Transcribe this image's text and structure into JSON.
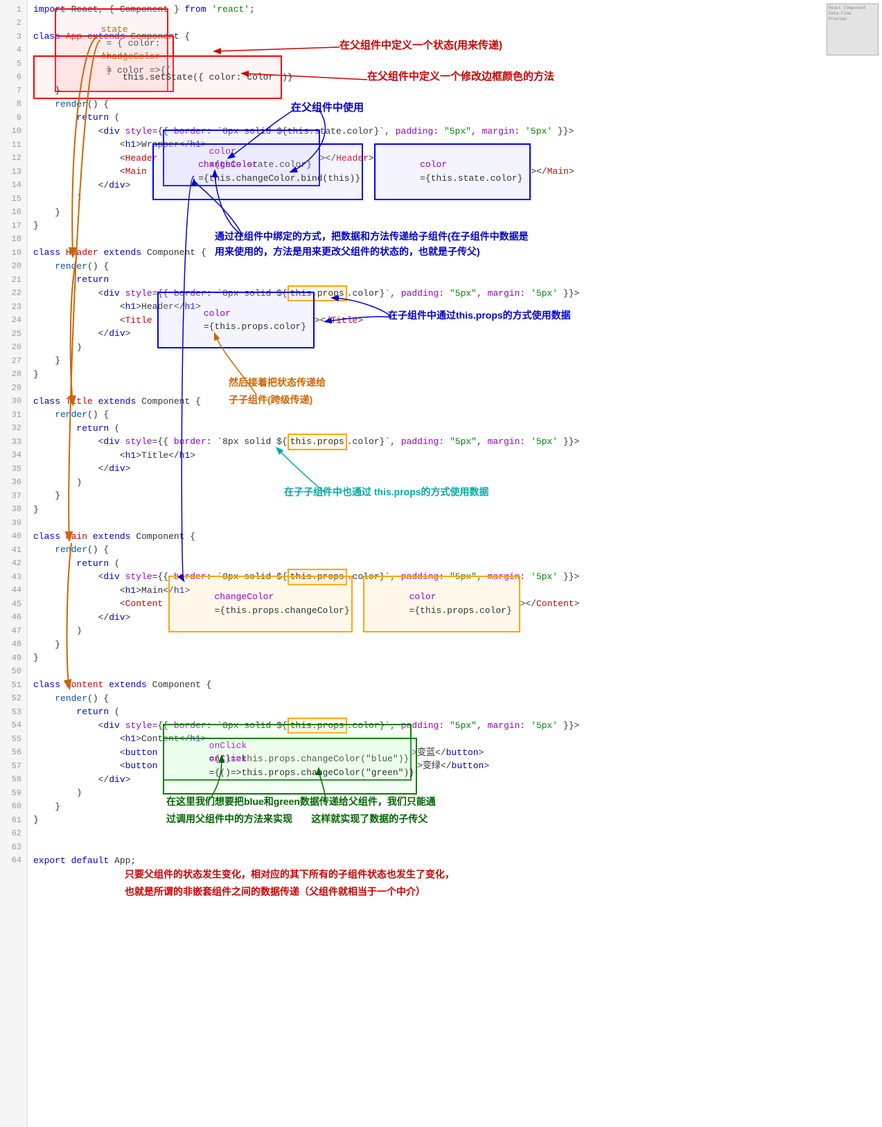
{
  "lines": [
    {
      "n": 1,
      "code": "import React, { Component } from 'react';"
    },
    {
      "n": 2,
      "code": ""
    },
    {
      "n": 3,
      "code": "class App extends Component {"
    },
    {
      "n": 4,
      "code": "    state = { color: 'red' }"
    },
    {
      "n": 5,
      "code": "    changeColor = color => {"
    },
    {
      "n": 6,
      "code": "        this.setState({ color: color })"
    },
    {
      "n": 7,
      "code": "    }"
    },
    {
      "n": 8,
      "code": "    render() {"
    },
    {
      "n": 9,
      "code": "        return ("
    },
    {
      "n": 10,
      "code": "            <div style={{ border: `8px solid ${this.state.color}`, padding: \"5px\", margin: '5px' }}>"
    },
    {
      "n": 11,
      "code": "                <h1>Wrapper</h1>"
    },
    {
      "n": 12,
      "code": "                <Header color={this.state.color} ></Header>"
    },
    {
      "n": 13,
      "code": "                <Main changeColor={this.changeColor.bind(this)}  color={this.state.color} ></Main>"
    },
    {
      "n": 14,
      "code": "            </div>"
    },
    {
      "n": 15,
      "code": "        )"
    },
    {
      "n": 16,
      "code": "    }"
    },
    {
      "n": 17,
      "code": "}"
    },
    {
      "n": 18,
      "code": ""
    },
    {
      "n": 19,
      "code": "class Header extends Component {"
    },
    {
      "n": 20,
      "code": "    render() {"
    },
    {
      "n": 21,
      "code": "        return"
    },
    {
      "n": 22,
      "code": "            <div style={{ border: `8px solid ${this.props.color}`, padding: \"5px\", margin: '5px' }}>"
    },
    {
      "n": 23,
      "code": "                <h1>Header</h1>"
    },
    {
      "n": 24,
      "code": "                <Title color={this.props.color} ></Title>"
    },
    {
      "n": 25,
      "code": "            </div>"
    },
    {
      "n": 26,
      "code": "        )"
    },
    {
      "n": 27,
      "code": "    }"
    },
    {
      "n": 28,
      "code": "}"
    },
    {
      "n": 29,
      "code": ""
    },
    {
      "n": 30,
      "code": "class Title extends Component {"
    },
    {
      "n": 31,
      "code": "    render() {"
    },
    {
      "n": 32,
      "code": "        return ("
    },
    {
      "n": 33,
      "code": "            <div style={{ border: `8px solid ${this.props.color}`, padding: \"5px\", margin: '5px' }}>"
    },
    {
      "n": 34,
      "code": "                <h1>Title</h1>"
    },
    {
      "n": 35,
      "code": "            </div>"
    },
    {
      "n": 36,
      "code": "        )"
    },
    {
      "n": 37,
      "code": "    }"
    },
    {
      "n": 38,
      "code": "}"
    },
    {
      "n": 39,
      "code": ""
    },
    {
      "n": 40,
      "code": "class Main extends Component {"
    },
    {
      "n": 41,
      "code": "    render() {"
    },
    {
      "n": 42,
      "code": "        return ("
    },
    {
      "n": 43,
      "code": "            <div style={{ border: `8px solid ${this.props.color}`, padding: \"5px\", margin: '5px' }}>"
    },
    {
      "n": 44,
      "code": "                <h1>Main</h1>"
    },
    {
      "n": 45,
      "code": "                <Content changeColor={this.props.changeColor}  color={this.props.color} ></Content>"
    },
    {
      "n": 46,
      "code": "            </div>"
    },
    {
      "n": 47,
      "code": "        )"
    },
    {
      "n": 48,
      "code": "    }"
    },
    {
      "n": 49,
      "code": "}"
    },
    {
      "n": 50,
      "code": ""
    },
    {
      "n": 51,
      "code": "class Content extends Component {"
    },
    {
      "n": 52,
      "code": "    render() {"
    },
    {
      "n": 53,
      "code": "        return ("
    },
    {
      "n": 54,
      "code": "            <div style={{ border: `8px solid ${this.props.color}`, padding: \"5px\", margin: '5px' }}>"
    },
    {
      "n": 55,
      "code": "                <h1>Content</h1>"
    },
    {
      "n": 56,
      "code": "                <button onClick={()=>this.props.changeColor(\"blue\")}>变蓝</button>"
    },
    {
      "n": 57,
      "code": "                <button onClick={()=>this.props.changeColor(\"green\")}>变绿</button>"
    },
    {
      "n": 58,
      "code": "            </div>"
    },
    {
      "n": 59,
      "code": "        )"
    },
    {
      "n": 60,
      "code": "    }"
    },
    {
      "n": 61,
      "code": "}"
    },
    {
      "n": 62,
      "code": ""
    },
    {
      "n": 63,
      "code": ""
    },
    {
      "n": 64,
      "code": "export default App;"
    }
  ],
  "annotations": {
    "ann1": "在父组件中定义一个状态(用来传递)",
    "ann2": "在父组件中定义一个修改边框颜色的方法",
    "ann3": "在父组件中使用",
    "ann4": "通过在组件中绑定的方式，把数据和方法传递给子组件(在子组件中数据是",
    "ann4b": "用来使用的，方法是用来更改父组件的状态的，也就是子传父)",
    "ann5": "在子组件中通过this.props的方式使用数据",
    "ann6_1": "然后接着把状态传递给",
    "ann6_2": "子子组件(跨级传递)",
    "ann7": "在子子组件中也通过 this.props的方式使用数据",
    "ann8_1": "在这里我们想要把blue和green数据传递给父组件，我们只能通",
    "ann8_2": "过调用父组件中的方法来实现        这样就实现了数据的子传父",
    "ann9_1": "只要父组件的状态发生变化，相对应的其下所有的子组件状态也发生了变化，",
    "ann9_2": "也就是所谓的非嵌套组件之间的数据传递（父组件就相当于一个中介）"
  }
}
